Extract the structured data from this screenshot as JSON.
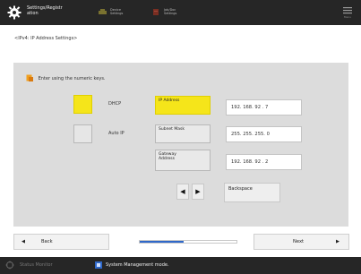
{
  "header": {
    "app_title": "Settings/Registr ation",
    "items": [
      {
        "label": "Device Settings",
        "icon": "printer-icon"
      },
      {
        "label": "Job/Doc Settings",
        "icon": "document-icon"
      }
    ],
    "menu_label": "Menu",
    "menu_icon": "hamburger-menu-icon"
  },
  "breadcrumb": "<IPv4: IP Address Settings>",
  "panel": {
    "instruction": "Enter using the numeric keys.",
    "options": [
      {
        "label": "DHCP",
        "selected": true
      },
      {
        "label": "Auto IP",
        "selected": false
      }
    ],
    "fields": [
      {
        "label": "IP Address",
        "value": "192. 168. 92 . 7",
        "selected": true
      },
      {
        "label": "Subnet Mask",
        "value": "255. 255. 255. 0",
        "selected": false
      },
      {
        "label_line1": "Gateway",
        "label_line2": "Address",
        "value": "192. 168. 92 . 2",
        "selected": false
      }
    ],
    "left_arrow": "◀",
    "right_arrow": "▶",
    "backspace_label": "Backspace"
  },
  "footer": {
    "back_label": "Back",
    "back_arrow": "◀",
    "next_label": "Next",
    "next_arrow": "▶",
    "progress_fraction": 0.45
  },
  "status_bar": {
    "monitor_label": "Status Monitor",
    "message": "System Management mode."
  },
  "colors": {
    "selected": "#f5e51a",
    "accent_blue": "#2f68c9",
    "dark_bar": "#262626"
  }
}
